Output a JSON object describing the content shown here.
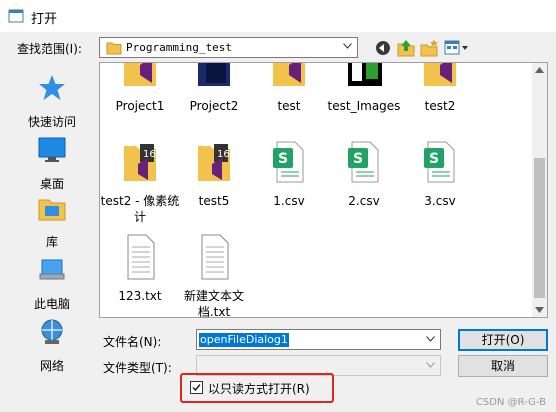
{
  "window": {
    "title": "打开"
  },
  "lookin": {
    "label": "查找范围(I):",
    "path": "Programming_test"
  },
  "places": [
    {
      "label": "快速访问",
      "icon": "star-icon"
    },
    {
      "label": "桌面",
      "icon": "desktop-icon"
    },
    {
      "label": "库",
      "icon": "library-icon"
    },
    {
      "label": "此电脑",
      "icon": "computer-icon"
    },
    {
      "label": "网络",
      "icon": "network-icon"
    }
  ],
  "files": {
    "row1": [
      "Project1",
      "Project2",
      "test",
      "test_Images",
      "test2"
    ],
    "row2": [
      "test2 - 像素统计",
      "test5",
      "1.csv",
      "2.csv",
      "3.csv"
    ],
    "row3": [
      "123.txt",
      "新建文本文档.txt"
    ]
  },
  "form": {
    "filename_label": "文件名(N):",
    "filename_value": "openFileDialog1",
    "filetype_label": "文件类型(T):",
    "open_button": "打开(O)",
    "cancel_button": "取消",
    "readonly_label": "以只读方式打开(R)"
  },
  "watermark": "CSDN @R-G-B",
  "colors": {
    "accent": "#0078d7",
    "highlight_box": "#e1251b",
    "csv_green": "#21a366",
    "vs_purple": "#68217a",
    "folder_yellow": "#f3c24a"
  }
}
